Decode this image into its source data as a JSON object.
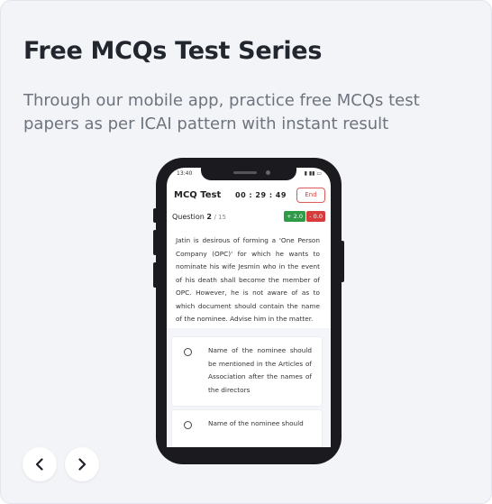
{
  "card": {
    "title": "Free MCQs Test Series",
    "subtitle": "Through our mobile app, practice free MCQs test papers as per ICAI pattern with instant result"
  },
  "phone": {
    "status_time": "13:40",
    "status_icons": "▮ ▮▮ ▭",
    "app_title": "MCQ Test",
    "timer": "00 : 29 : 49",
    "end_label": "End",
    "question_label": "Question",
    "question_number": "2",
    "question_total": "/ 15",
    "positive_mark": "+ 2.0",
    "negative_mark": "- 0.0",
    "question_text": "Jatin is desirous of forming a 'One Person Company (OPC)' for which he wants to nominate his wife Jesmin who in the event of his death shall become the member of OPC. However, he is not aware of as to which document should contain the name of the nominee. Advise him in the matter.",
    "options": [
      "Name of the nominee should be mentioned in the Articles of Association after the names of the directors",
      "Name of the nominee should"
    ]
  },
  "nav": {
    "prev_icon": "chevron-left-icon",
    "next_icon": "chevron-right-icon"
  },
  "colors": {
    "accent_red": "#d83b3b",
    "accent_green": "#2e9b47"
  }
}
